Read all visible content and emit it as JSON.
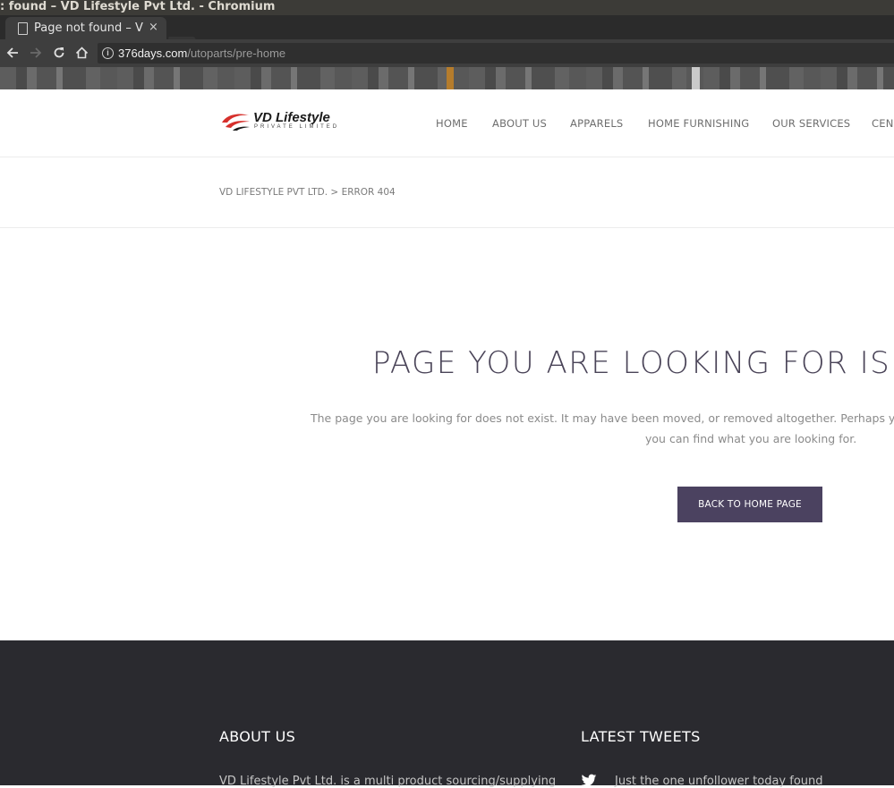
{
  "browser": {
    "window_title": ": found – VD Lifestyle Pvt Ltd. - Chromium",
    "tab_title": "Page not found – VD Lifestyle Pvt Ltd.",
    "tab_close": "×",
    "url_host": "376days.com",
    "url_path": "/utoparts/pre-home",
    "icons": {
      "back": "arrow-left-icon",
      "forward": "arrow-right-icon",
      "reload": "reload-icon",
      "home": "home-icon",
      "site_info": "info-icon",
      "tab": "document-icon"
    }
  },
  "site": {
    "logo_title": "VD Lifestyle",
    "logo_subtitle": "PRIVATE LIMITED",
    "nav": [
      "HOME",
      "ABOUT US",
      "APPARELS",
      "HOME FURNISHING",
      "OUR SERVICES",
      "CEN"
    ],
    "breadcrumb": {
      "home": "VD LIFESTYLE PVT LTD.",
      "separator": ">",
      "current": "ERROR 404"
    },
    "colors": {
      "accent": "#4b4260",
      "logo_red": "#d6302c",
      "footer_bg": "#2a2a2f"
    }
  },
  "error_page": {
    "title": "PAGE YOU ARE LOOKING FOR IS",
    "text_line1": "The page you are looking for does not exist. It may have been moved, or removed altogether. Perhaps y",
    "text_line2": "you can find what you are looking for.",
    "button_label": "BACK TO HOME PAGE"
  },
  "footer": {
    "about_heading": "ABOUT US",
    "about_text": "VD Lifestyle Pvt Ltd. is a multi product sourcing/supplying",
    "tweets_heading": "LATEST TWEETS",
    "tweet_text": "Just the one unfollower today found"
  }
}
